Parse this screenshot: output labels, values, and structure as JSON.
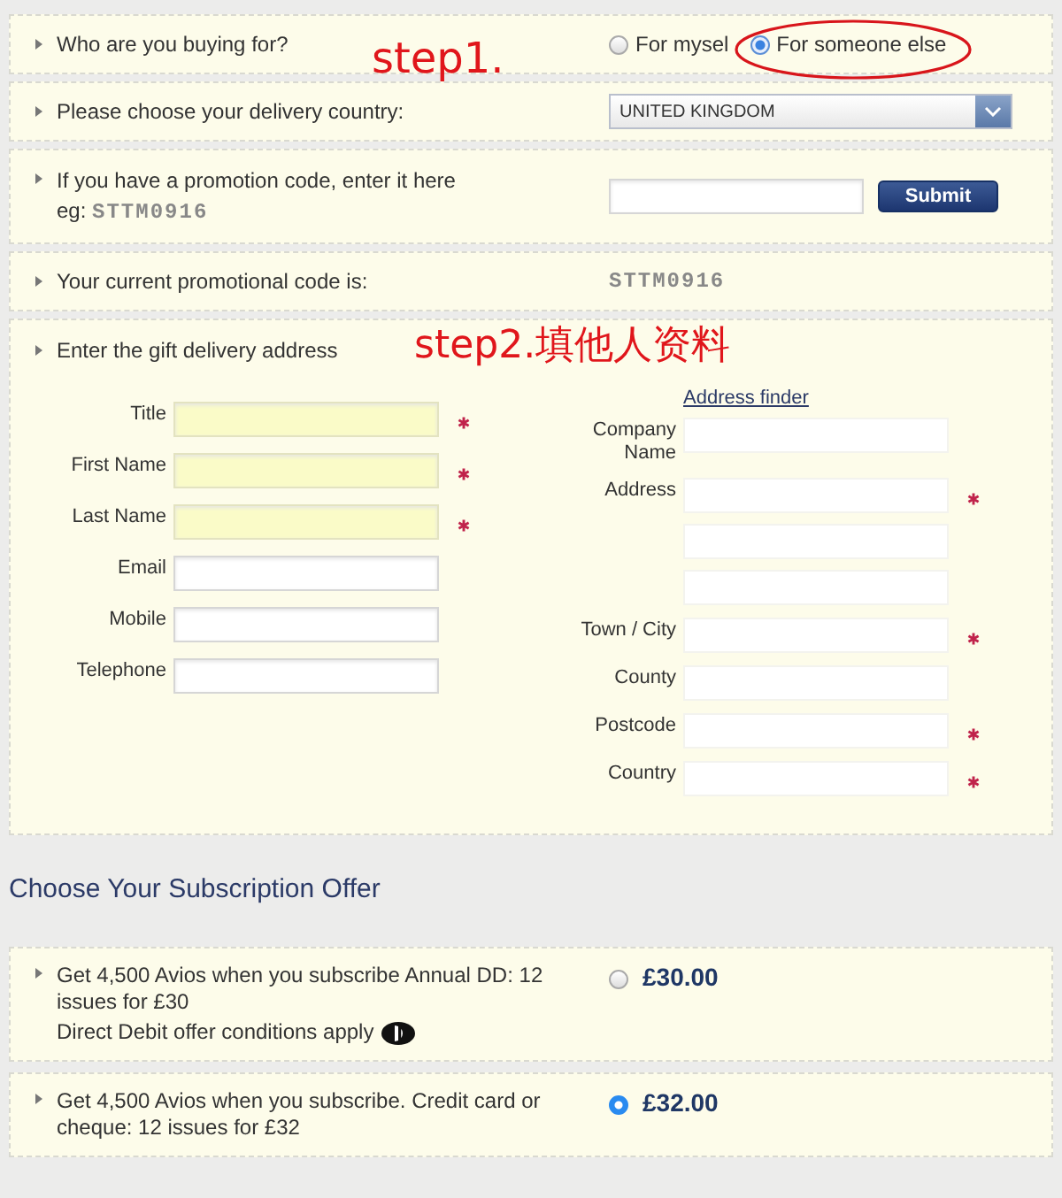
{
  "annotations": [
    {
      "text": "step1."
    },
    {
      "text": "step2.填他人资料"
    }
  ],
  "buyer": {
    "label": "Who are you buying for?",
    "options": [
      {
        "label": "For mysel",
        "selected": false
      },
      {
        "label": "For someone else",
        "selected": true
      }
    ]
  },
  "country": {
    "label": "Please choose your delivery country:",
    "value": "UNITED KINGDOM"
  },
  "promo": {
    "label": "If you have a promotion code, enter it here",
    "example_label": "eg:",
    "example_code": "STTM0916",
    "button": "Submit"
  },
  "current_code": {
    "label": "Your current promotional code is:",
    "value": "STTM0916"
  },
  "gift_address": {
    "heading": "Enter the gift delivery address",
    "address_finder": "Address finder",
    "left_fields": [
      {
        "label": "Title",
        "required": true,
        "autofilled": true
      },
      {
        "label": "First Name",
        "required": true,
        "autofilled": true
      },
      {
        "label": "Last Name",
        "required": true,
        "autofilled": true
      },
      {
        "label": "Email",
        "required": false,
        "autofilled": false
      },
      {
        "label": "Mobile",
        "required": false,
        "autofilled": false
      },
      {
        "label": "Telephone",
        "required": false,
        "autofilled": false
      }
    ],
    "right_fields": [
      {
        "label": "Company Name",
        "kind": "single",
        "required": false
      },
      {
        "label": "Address",
        "kind": "address",
        "required": true
      },
      {
        "label": "Town / City",
        "kind": "single",
        "required": true
      },
      {
        "label": "County",
        "kind": "single",
        "required": false
      },
      {
        "label": "Postcode",
        "kind": "single",
        "required": true
      },
      {
        "label": "Country",
        "kind": "single",
        "required": true
      }
    ]
  },
  "offers": {
    "heading": "Choose Your Subscription Offer",
    "items": [
      {
        "text": "Get 4,500 Avios when you subscribe Annual DD: 12 issues for £30",
        "note": "Direct Debit offer conditions apply",
        "price": "£30.00",
        "selected": false
      },
      {
        "text": "Get 4,500 Avios when you subscribe. Credit card or cheque: 12 issues for £32",
        "price": "£32.00",
        "selected": true
      }
    ]
  }
}
